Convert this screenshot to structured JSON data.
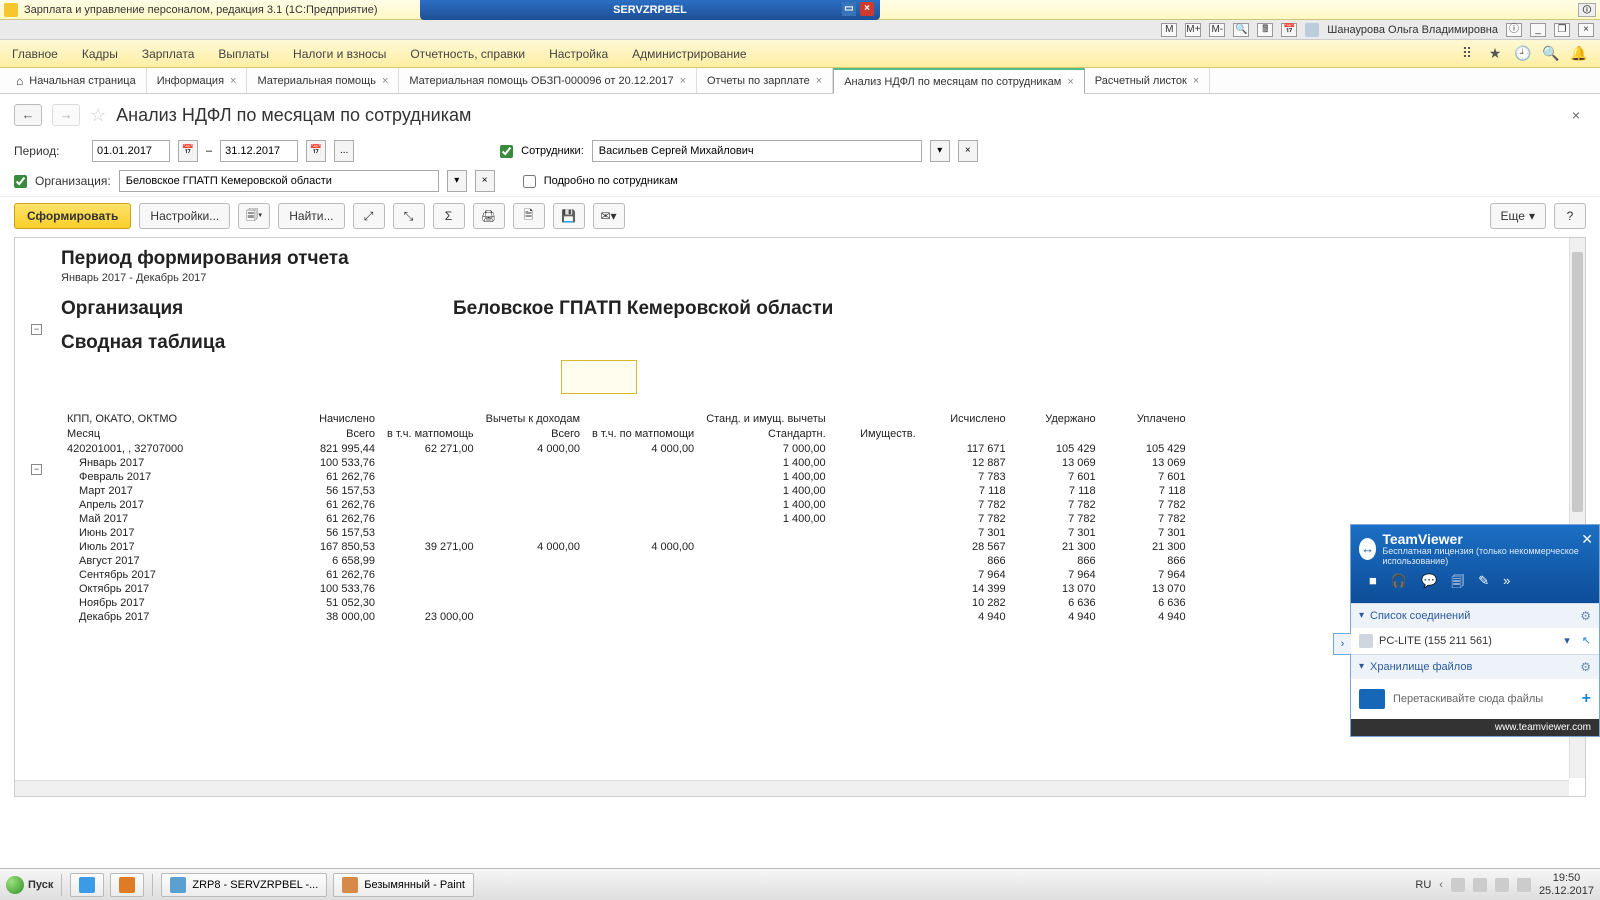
{
  "window1c": {
    "title": "Зарплата и управление персоналом, редакция 3.1  (1С:Предприятие)"
  },
  "tv_strip": {
    "title": "SERVZRPBEL"
  },
  "second_title": {
    "m_labels": [
      "M",
      "M+",
      "M-"
    ],
    "user": "Шанаурова Ольга Владимировна"
  },
  "main_menu": [
    "Главное",
    "Кадры",
    "Зарплата",
    "Выплаты",
    "Налоги и взносы",
    "Отчетность, справки",
    "Настройка",
    "Администрирование"
  ],
  "tabs": [
    {
      "label": "Начальная страница",
      "home": true,
      "closable": false
    },
    {
      "label": "Информация",
      "closable": true
    },
    {
      "label": "Материальная помощь",
      "closable": true
    },
    {
      "label": "Материальная помощь ОБЗП-000096 от 20.12.2017",
      "closable": true
    },
    {
      "label": "Отчеты по зарплате",
      "closable": true
    },
    {
      "label": "Анализ НДФЛ по месяцам по сотрудникам",
      "closable": true,
      "active": true
    },
    {
      "label": "Расчетный листок",
      "closable": true
    }
  ],
  "page": {
    "title": "Анализ НДФЛ по месяцам по сотрудникам",
    "period_label": "Период:",
    "date_from": "01.01.2017",
    "date_sep": "–",
    "date_to": "31.12.2017",
    "dots": "...",
    "emp_label": "Сотрудники:",
    "emp_value": "Васильев Сергей Михайлович",
    "org_label": "Организация:",
    "org_value": "Беловское ГПАТП Кемеровской области",
    "detail_label": "Подробно по сотрудникам"
  },
  "toolbar": {
    "form": "Сформировать",
    "settings": "Настройки...",
    "find": "Найти...",
    "more": "Еще"
  },
  "report": {
    "title": "Период формирования отчета",
    "period": "Январь 2017 - Декабрь 2017",
    "org_label": "Организация",
    "org_value": "Беловское ГПАТП Кемеровской области",
    "pivot": "Сводная таблица",
    "headers1": [
      "КПП, ОКАТО, ОКТМО",
      "Начислено",
      "",
      "Вычеты к доходам",
      "",
      "Станд. и имущ. вычеты",
      "",
      "Исчислено",
      "Удержано",
      "Уплачено"
    ],
    "headers2": [
      "Месяц",
      "Всего",
      "в т.ч. матпомощь",
      "Всего",
      "в т.ч. по матпомощи",
      "Стандартн.",
      "Имуществ.",
      "",
      "",
      ""
    ],
    "total": [
      "420201001, , 32707000",
      "821 995,44",
      "62 271,00",
      "4 000,00",
      "4 000,00",
      "7 000,00",
      "",
      "117 671",
      "105 429",
      "105 429"
    ],
    "rows": [
      [
        "Январь 2017",
        "100 533,76",
        "",
        "",
        "",
        "1 400,00",
        "",
        "12 887",
        "13 069",
        "13 069"
      ],
      [
        "Февраль 2017",
        "61 262,76",
        "",
        "",
        "",
        "1 400,00",
        "",
        "7 783",
        "7 601",
        "7 601"
      ],
      [
        "Март 2017",
        "56 157,53",
        "",
        "",
        "",
        "1 400,00",
        "",
        "7 118",
        "7 118",
        "7 118"
      ],
      [
        "Апрель 2017",
        "61 262,76",
        "",
        "",
        "",
        "1 400,00",
        "",
        "7 782",
        "7 782",
        "7 782"
      ],
      [
        "Май 2017",
        "61 262,76",
        "",
        "",
        "",
        "1 400,00",
        "",
        "7 782",
        "7 782",
        "7 782"
      ],
      [
        "Июнь 2017",
        "56 157,53",
        "",
        "",
        "",
        "",
        "",
        "7 301",
        "7 301",
        "7 301"
      ],
      [
        "Июль 2017",
        "167 850,53",
        "39 271,00",
        "4 000,00",
        "4 000,00",
        "",
        "",
        "28 567",
        "21 300",
        "21 300"
      ],
      [
        "Август 2017",
        "6 658,99",
        "",
        "",
        "",
        "",
        "",
        "866",
        "866",
        "866"
      ],
      [
        "Сентябрь 2017",
        "61 262,76",
        "",
        "",
        "",
        "",
        "",
        "7 964",
        "7 964",
        "7 964"
      ],
      [
        "Октябрь 2017",
        "100 533,76",
        "",
        "",
        "",
        "",
        "",
        "14 399",
        "13 070",
        "13 070"
      ],
      [
        "Ноябрь 2017",
        "51 052,30",
        "",
        "",
        "",
        "",
        "",
        "10 282",
        "6 636",
        "6 636"
      ],
      [
        "Декабрь 2017",
        "38 000,00",
        "23 000,00",
        "",
        "",
        "",
        "",
        "4 940",
        "4 940",
        "4 940"
      ]
    ]
  },
  "teamviewer": {
    "title": "TeamViewer",
    "sub": "Бесплатная лицензия (только некоммерческое использование)",
    "section1": "Список соединений",
    "peer": "PC-LITE (155 211 561)",
    "section2": "Хранилище файлов",
    "drop": "Перетаскивайте сюда файлы",
    "footer": "www.teamviewer.com"
  },
  "taskbar": {
    "start": "Пуск",
    "items": [
      {
        "label": "ZRP8 - SERVZRPBEL -..."
      },
      {
        "label": "Безымянный - Paint"
      }
    ],
    "lang": "RU",
    "time": "19:50",
    "date": "25.12.2017"
  }
}
